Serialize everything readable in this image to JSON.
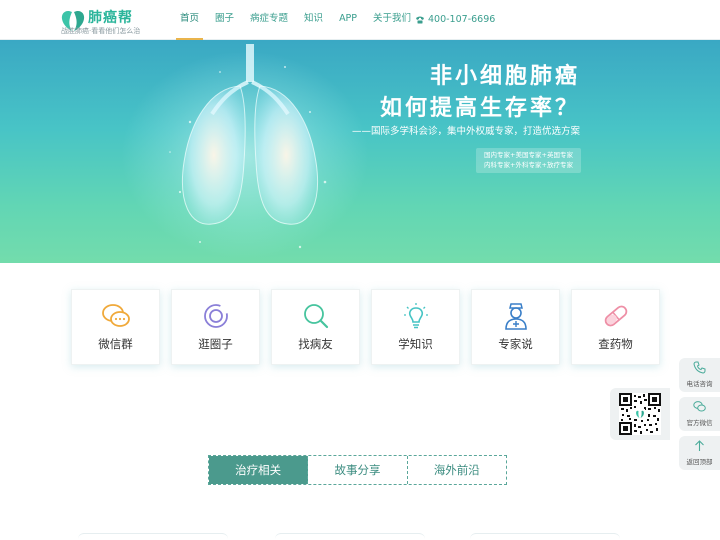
{
  "header": {
    "logo_name": "肺癌帮",
    "logo_slogan": "战胜肺癌·看看他们怎么治",
    "nav": [
      {
        "label": "首页",
        "active": true
      },
      {
        "label": "圈子",
        "active": false
      },
      {
        "label": "病症专题",
        "active": false
      },
      {
        "label": "知识",
        "active": false
      },
      {
        "label": "APP",
        "active": false
      },
      {
        "label": "关于我们",
        "active": false
      }
    ],
    "phone": "400-107-6696",
    "brand_color": "#2bb59b"
  },
  "banner": {
    "title_line1": "非小细胞肺癌",
    "title_line2": "如何提高生存率？",
    "subtitle": "——国际多学科会诊，集中外权威专家，打造优选方案",
    "tag_line1": "国内专家+美国专家+英国专家",
    "tag_line2": "内科专家+外科专家+放疗专家"
  },
  "cards": [
    {
      "label": "微信群",
      "icon": "wechat-icon"
    },
    {
      "label": "逛圈子",
      "icon": "circle-icon"
    },
    {
      "label": "找病友",
      "icon": "search-icon"
    },
    {
      "label": "学知识",
      "icon": "lightbulb-icon"
    },
    {
      "label": "专家说",
      "icon": "doctor-icon"
    },
    {
      "label": "查药物",
      "icon": "pill-icon"
    }
  ],
  "tabs": [
    {
      "label": "治疗相关",
      "active": true
    },
    {
      "label": "故事分享",
      "active": false
    },
    {
      "label": "海外前沿",
      "active": false
    }
  ],
  "float": {
    "phone_label": "电话咨询",
    "wechat_label": "官方微信",
    "top_label": "返回顶部"
  }
}
